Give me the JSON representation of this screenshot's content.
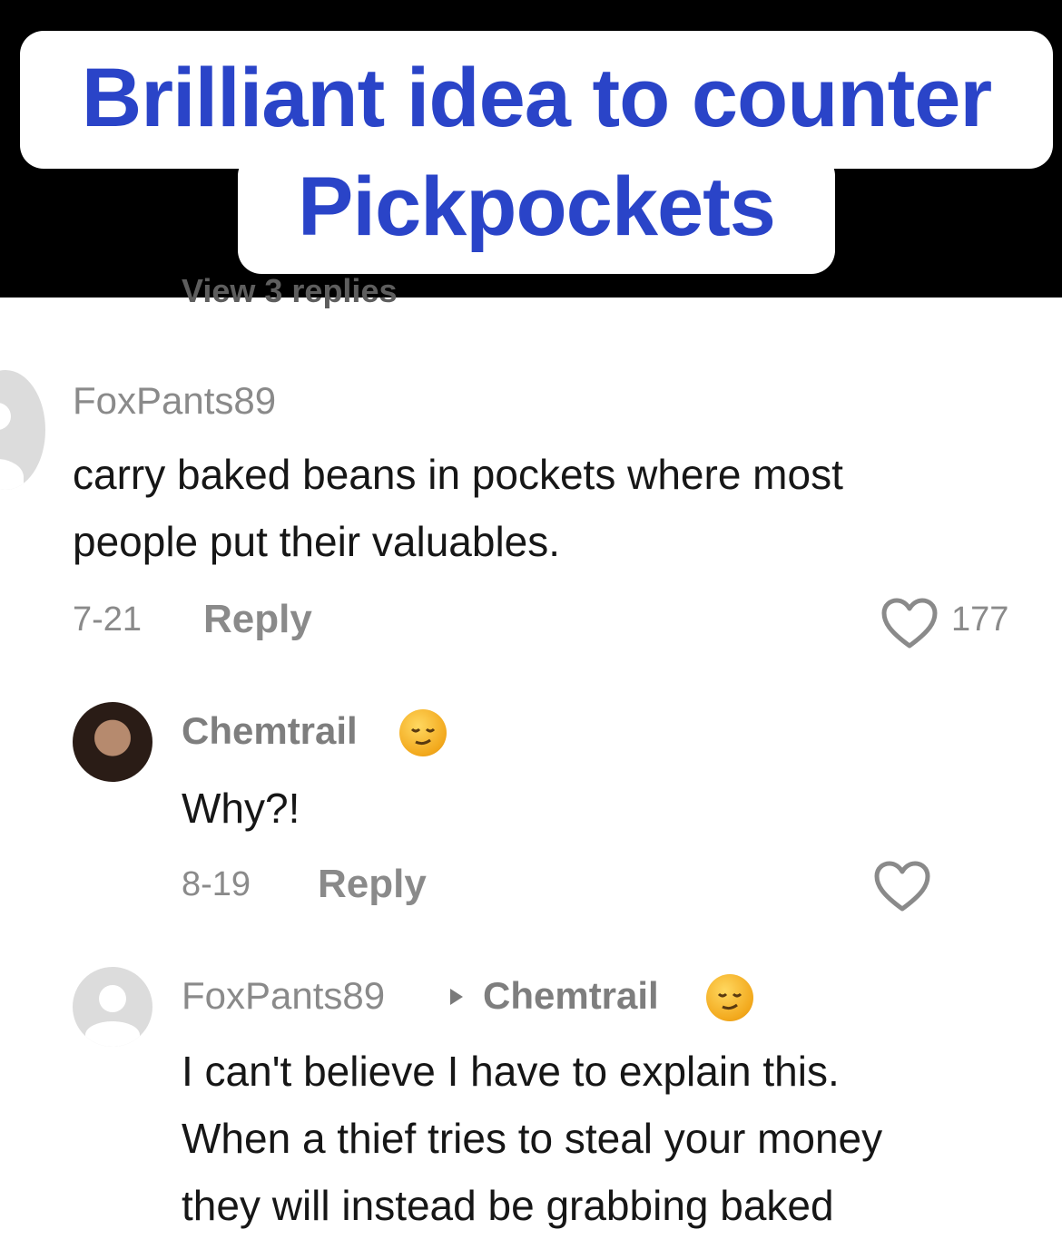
{
  "caption": {
    "line1": "Brilliant idea to counter",
    "line2": "Pickpockets"
  },
  "peek": {
    "text": "View 3 replies"
  },
  "comments": [
    {
      "username": "FoxPants89",
      "lines": [
        "carry baked beans in pockets where most",
        "people put their valuables."
      ],
      "date": "7-21",
      "reply_label": "Reply",
      "likes": "177"
    },
    {
      "username": "Chemtrail",
      "lines": [
        "Why?!"
      ],
      "date": "8-19",
      "reply_label": "Reply",
      "likes": ""
    },
    {
      "username": "FoxPants89",
      "reply_to": "Chemtrail",
      "lines": [
        "I can't believe I have to explain this.",
        "When a thief tries to steal your money",
        "they will instead be grabbing baked"
      ]
    }
  ],
  "icons": {
    "heart": "heart-icon",
    "emoji": "relieved-face-emoji",
    "arrow": "triangle-right-icon"
  },
  "colors": {
    "caption_text": "#2a44c8",
    "caption_bg": "#ffffff",
    "top_bg": "#000000",
    "muted": "#8a8a8a",
    "text": "#161616"
  }
}
